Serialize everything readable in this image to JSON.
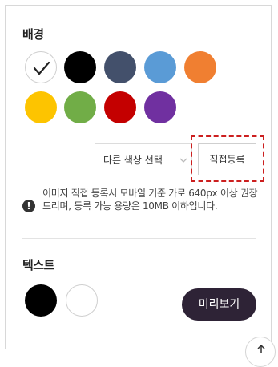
{
  "background_section": {
    "title": "배경",
    "swatches": [
      {
        "color": "#ffffff",
        "selected": true
      },
      {
        "color": "#000000",
        "selected": false
      },
      {
        "color": "#43506b",
        "selected": false
      },
      {
        "color": "#5a9bd6",
        "selected": false
      },
      {
        "color": "#f07f31",
        "selected": false
      },
      {
        "color": "#fdc400",
        "selected": false
      },
      {
        "color": "#71ad47",
        "selected": false
      },
      {
        "color": "#c40000",
        "selected": false
      },
      {
        "color": "#7030a0",
        "selected": false
      }
    ],
    "other_color_select": {
      "value": "다른 색상 선택",
      "icon": "chevron-down-icon"
    },
    "register_button_label": "직접등록",
    "info": {
      "icon": "exclamation-icon",
      "text": "이미지 직접 등록시 모바일 기준 가로 640px 이상 권장드리며, 등록 가능 용량은 10MB 이하입니다."
    }
  },
  "text_section": {
    "title": "텍스트",
    "swatches": [
      {
        "color": "#000000",
        "selected": false
      },
      {
        "color": "#ffffff",
        "selected": false
      }
    ]
  },
  "preview_button_label": "미리보기",
  "scroll_top_icon": "arrow-up-icon"
}
